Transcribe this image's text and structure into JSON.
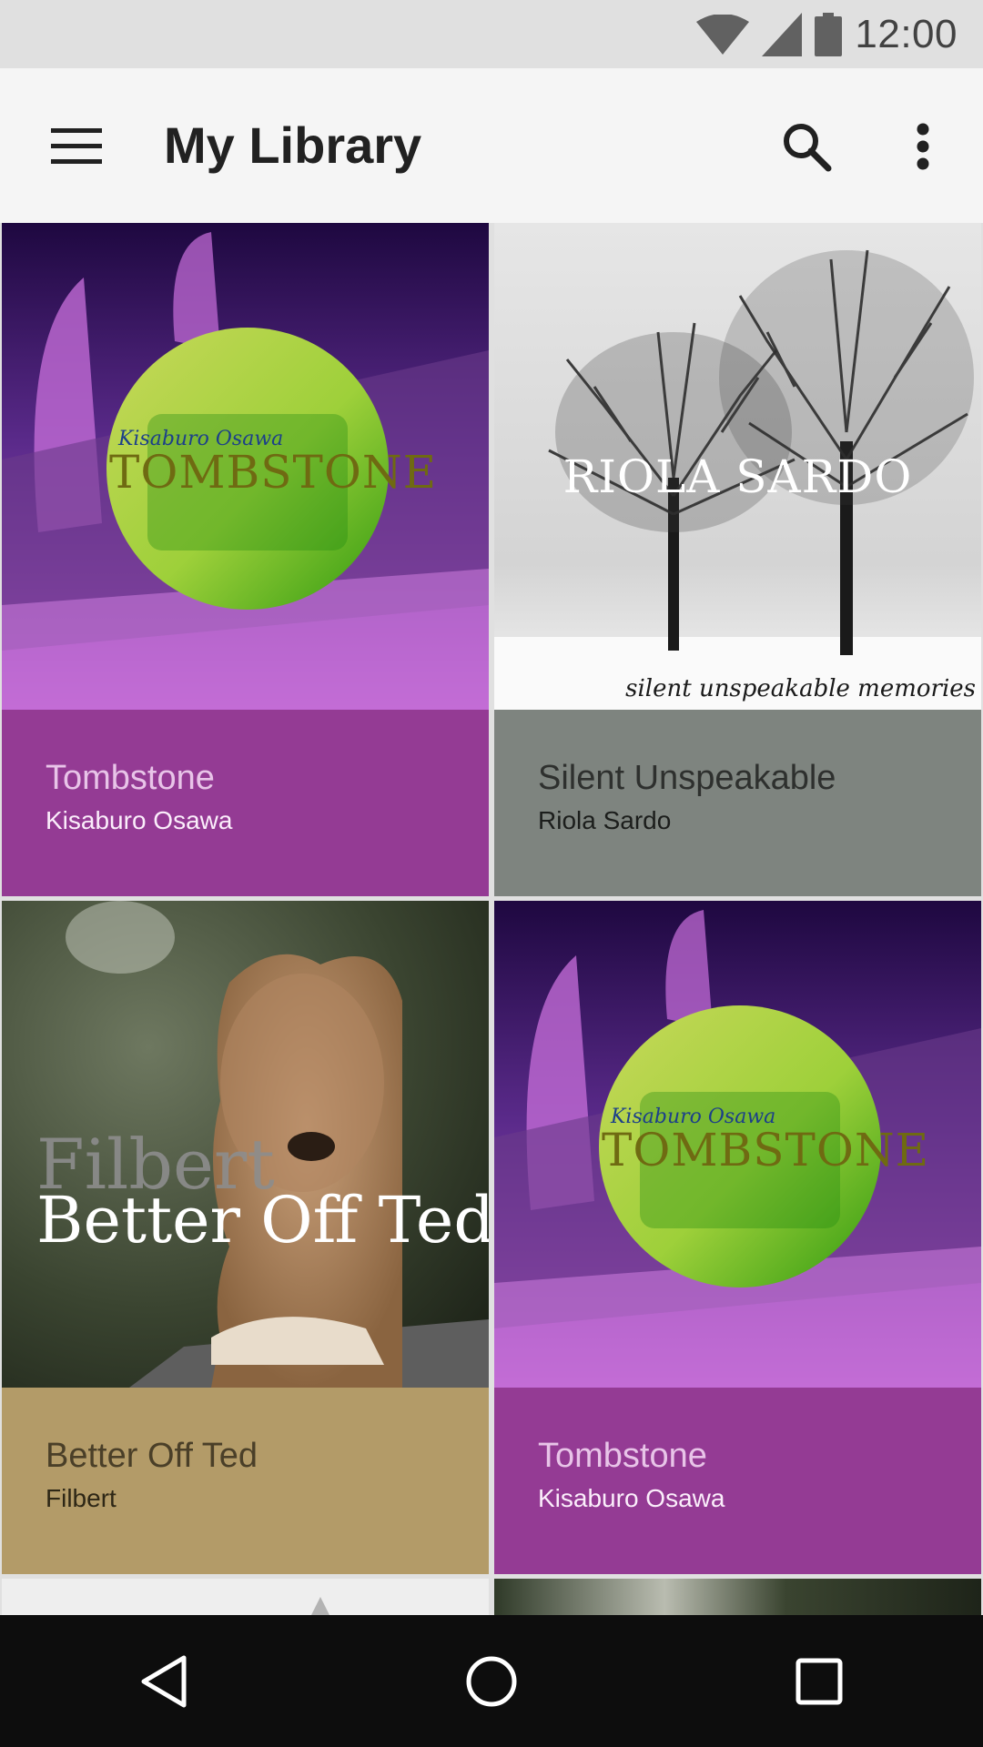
{
  "status_bar": {
    "time": "12:00"
  },
  "app_bar": {
    "title": "My Library",
    "menu_icon": "hamburger-menu-icon",
    "search_icon": "search-icon",
    "more_icon": "more-vert-icon"
  },
  "albums": [
    {
      "title": "Tombstone",
      "artist": "Kisaburo Osawa",
      "art_artist": "Kisaburo Osawa",
      "art_title": "TOMBSTONE",
      "color": "#943b94"
    },
    {
      "title": "Silent Unspeakable",
      "artist": "Riola Sardo",
      "art_artist": "RIOLA SARDO",
      "art_title": "silent unspeakable memories",
      "color": "#7e847f"
    },
    {
      "title": "Better Off Ted",
      "artist": "Filbert",
      "art_artist": "Filbert",
      "art_title": "Better Off Ted",
      "color": "#b39b68"
    },
    {
      "title": "Tombstone",
      "artist": "Kisaburo Osawa",
      "art_artist": "Kisaburo Osawa",
      "art_title": "TOMBSTONE",
      "color": "#943b94"
    }
  ],
  "nav_bar": {
    "back_icon": "back-icon",
    "home_icon": "home-icon",
    "recents_icon": "recents-icon"
  }
}
